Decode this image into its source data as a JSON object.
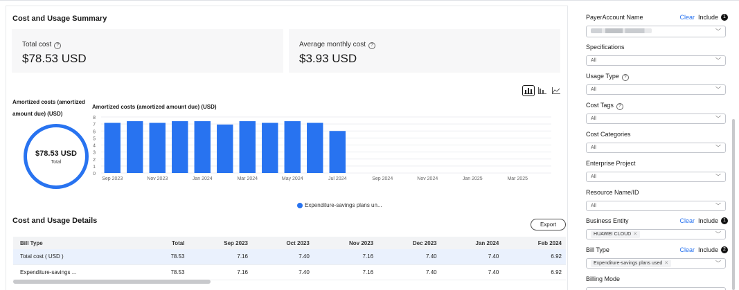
{
  "summary": {
    "title": "Cost and Usage Summary",
    "total_cost_label": "Total cost",
    "total_cost_value": "$78.53 USD",
    "avg_cost_label": "Average monthly cost",
    "avg_cost_value": "$3.93 USD",
    "help_glyph": "?"
  },
  "view_switch": {
    "icons": [
      "bar-chart-icon",
      "stacked-bar-icon",
      "line-chart-icon"
    ],
    "active": "bar-chart-icon"
  },
  "donut": {
    "title": "Amortized costs (amortized amount due) (USD)",
    "value": "$78.53 USD",
    "label": "Total",
    "color": "#2873f0"
  },
  "chart_data": {
    "type": "bar",
    "title": "Amortized costs (amortized amount due) (USD)",
    "categories": [
      "Sep 2023",
      "Oct 2023",
      "Nov 2023",
      "Dec 2023",
      "Jan 2024",
      "Feb 2024",
      "Mar 2024",
      "Apr 2024",
      "May 2024",
      "Jun 2024",
      "Jul 2024",
      "Aug 2024",
      "Sep 2024",
      "Oct 2024",
      "Nov 2024",
      "Dec 2024",
      "Jan 2025",
      "Feb 2025",
      "Mar 2025",
      "Apr 2025"
    ],
    "tick_labels": [
      "Sep 2023",
      "Nov 2023",
      "Jan 2024",
      "Mar 2024",
      "May 2024",
      "Jul 2024",
      "Sep 2024",
      "Nov 2024",
      "Jan 2025",
      "Mar 2025"
    ],
    "series": [
      {
        "name": "Expenditure-savings plans un...",
        "color": "#2873f0",
        "values": [
          7.16,
          7.4,
          7.16,
          7.4,
          7.4,
          6.92,
          7.4,
          7.16,
          7.4,
          7.16,
          6.0,
          null,
          null,
          null,
          null,
          null,
          null,
          null,
          null,
          null
        ]
      }
    ],
    "yticks": [
      0,
      1,
      2,
      3,
      4,
      5,
      6,
      7,
      8
    ],
    "ylim": [
      0,
      8
    ],
    "grid": true,
    "legend_position": "bottom"
  },
  "details": {
    "title": "Cost and Usage Details",
    "export_label": "Export",
    "columns": [
      "Bill Type",
      "Total",
      "Sep 2023",
      "Oct 2023",
      "Nov 2023",
      "Dec 2023",
      "Jan 2024",
      "Feb 2024"
    ],
    "rows": [
      [
        "Total cost ( USD )",
        "78.53",
        "7.16",
        "7.40",
        "7.16",
        "7.40",
        "7.40",
        "6.92"
      ],
      [
        "Expenditure-savings ...",
        "78.53",
        "7.16",
        "7.40",
        "7.16",
        "7.40",
        "7.40",
        "6.92"
      ]
    ]
  },
  "filters": {
    "payer_account": {
      "label": "PayerAccount Name",
      "clear": "Clear",
      "include": "Include",
      "count": "1"
    },
    "specifications": {
      "label": "Specifications",
      "value": "All"
    },
    "usage_type": {
      "label": "Usage Type",
      "value": "All"
    },
    "cost_tags": {
      "label": "Cost Tags",
      "value": "All"
    },
    "cost_categories": {
      "label": "Cost Categories",
      "value": "All"
    },
    "enterprise_project": {
      "label": "Enterprise Project",
      "value": "All"
    },
    "resource": {
      "label": "Resource Name/ID",
      "value": "All"
    },
    "business_entity": {
      "label": "Business Entity",
      "clear": "Clear",
      "include": "Include",
      "count": "1",
      "tag": "HUAWEI CLOUD"
    },
    "bill_type": {
      "label": "Bill Type",
      "clear": "Clear",
      "include": "Include",
      "count": "2",
      "tag": "Expenditure-savings plans used"
    },
    "billing_mode": {
      "label": "Billing Mode"
    }
  }
}
